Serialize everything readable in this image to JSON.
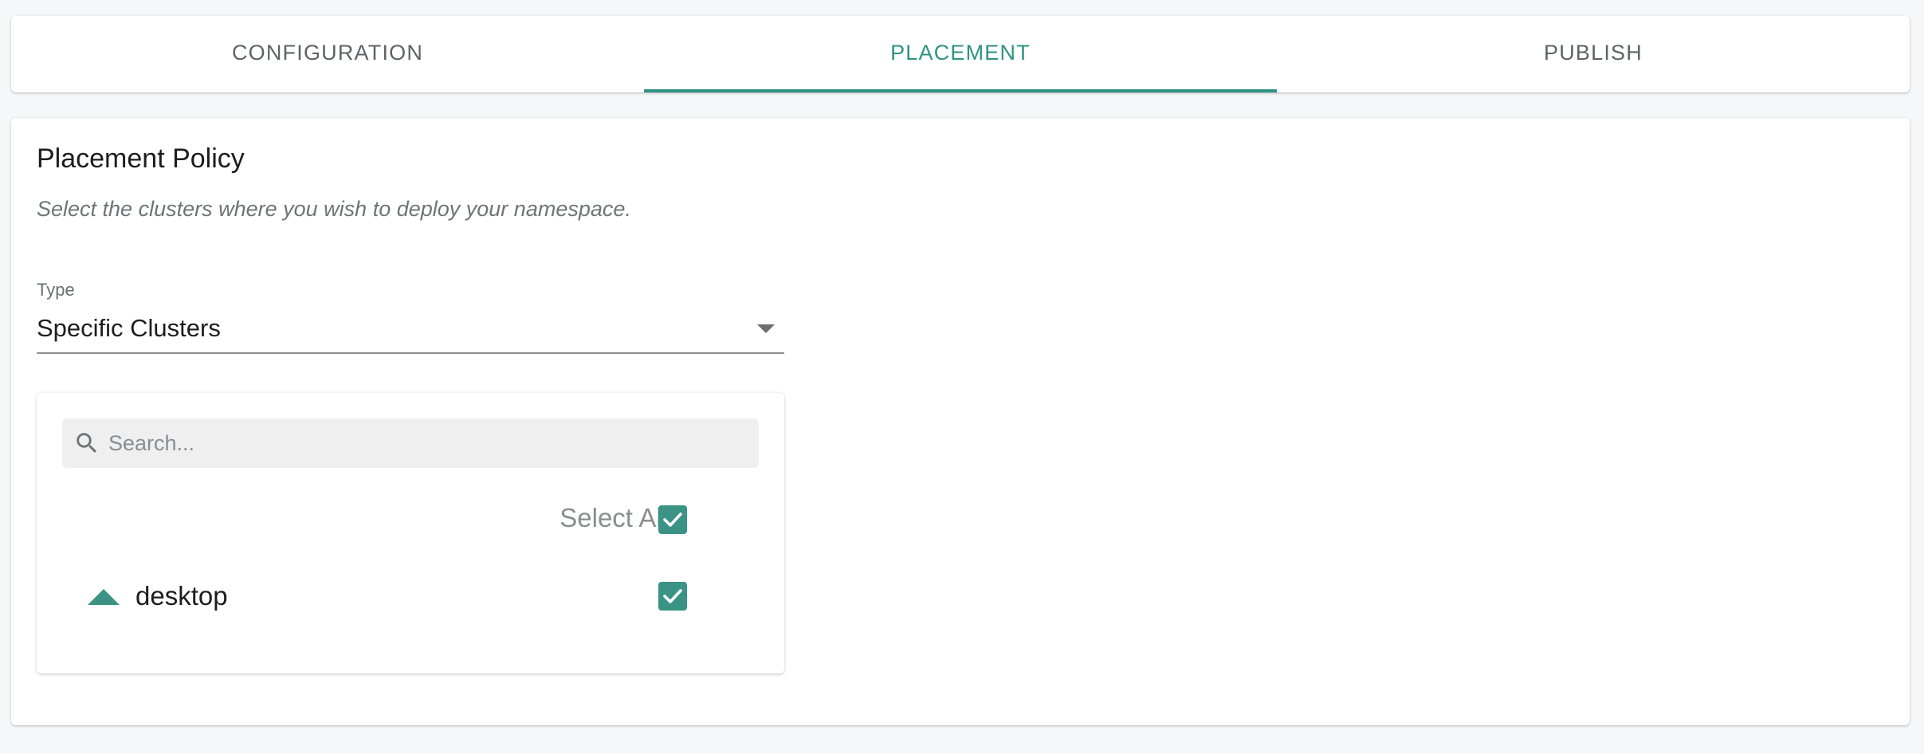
{
  "tabs": [
    {
      "label": "CONFIGURATION",
      "active": false
    },
    {
      "label": "PLACEMENT",
      "active": true
    },
    {
      "label": "PUBLISH",
      "active": false
    }
  ],
  "placement": {
    "title": "Placement Policy",
    "description": "Select the clusters where you wish to deploy your namespace.",
    "type_label": "Type",
    "type_value": "Specific Clusters",
    "search": {
      "placeholder": "Search...",
      "value": ""
    },
    "select_all": {
      "label": "Select All",
      "checked": true
    },
    "clusters": [
      {
        "name": "desktop",
        "checked": true,
        "expanded": true
      }
    ]
  },
  "colors": {
    "accent": "#2f9284",
    "checkbox": "#3a9384",
    "background": "#f6f7f9"
  },
  "icons": [
    "search-icon",
    "chevron-down-icon",
    "check-icon",
    "expand-up-icon"
  ]
}
